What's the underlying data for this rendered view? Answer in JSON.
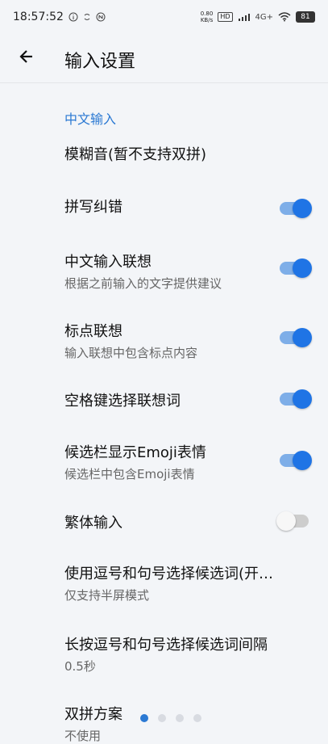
{
  "status": {
    "time": "18:57:52",
    "icons_left": [
      "info-icon",
      "sync-icon",
      "nfc-icon"
    ],
    "net_speed_top": "0.80",
    "net_speed_bottom": "KB/s",
    "hd": "HD",
    "signal": "4G+",
    "battery": "81"
  },
  "header": {
    "title": "输入设置"
  },
  "section": {
    "title": "中文输入"
  },
  "settings": [
    {
      "title": "模糊音(暂不支持双拼)",
      "subtitle": "",
      "toggle": null
    },
    {
      "title": "拼写纠错",
      "subtitle": "",
      "toggle": true
    },
    {
      "title": "中文输入联想",
      "subtitle": "根据之前输入的文字提供建议",
      "toggle": true
    },
    {
      "title": "标点联想",
      "subtitle": "输入联想中包含标点内容",
      "toggle": true
    },
    {
      "title": "空格键选择联想词",
      "subtitle": "",
      "toggle": true
    },
    {
      "title": "候选栏显示Emoji表情",
      "subtitle": "候选栏中包含Emoji表情",
      "toggle": true
    },
    {
      "title": "繁体输入",
      "subtitle": "",
      "toggle": false
    },
    {
      "title": "使用逗号和句号选择候选词(开…",
      "subtitle": "仅支持半屏模式",
      "toggle": null
    },
    {
      "title": "长按逗号和句号选择候选词间隔",
      "subtitle": "0.5秒",
      "toggle": null
    },
    {
      "title": "双拼方案",
      "subtitle": "不使用",
      "toggle": null
    }
  ],
  "colors": {
    "accent": "#1f74e5",
    "section": "#2b79d3",
    "toggle_track_on": "#7eaee8",
    "toggle_track_off": "#cdcdcd"
  },
  "pagination": {
    "total": 4,
    "active": 1
  }
}
